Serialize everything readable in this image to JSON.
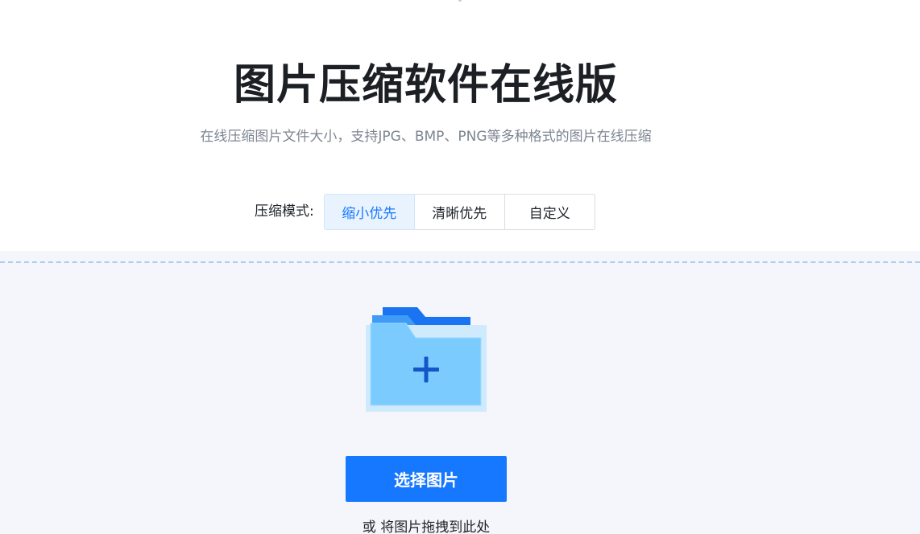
{
  "header": {
    "title": "图片压缩软件在线版",
    "subtitle": "在线压缩图片文件大小，支持JPG、BMP、PNG等多种格式的图片在线压缩"
  },
  "mode": {
    "label": "压缩模式:",
    "options": [
      {
        "label": "缩小优先",
        "active": true
      },
      {
        "label": "清晰优先",
        "active": false
      },
      {
        "label": "自定义",
        "active": false
      }
    ]
  },
  "upload": {
    "icon": "folder-plus-icon",
    "button_label": "选择图片",
    "drag_hint": "或 将图片拖拽到此处"
  },
  "colors": {
    "accent": "#1677ff",
    "active_tab_bg": "#e9f3fe",
    "upload_bg": "#f4f6fb",
    "dashed_border": "#a9cdf4",
    "title": "#1c1f24",
    "subtitle": "#7d8592"
  }
}
